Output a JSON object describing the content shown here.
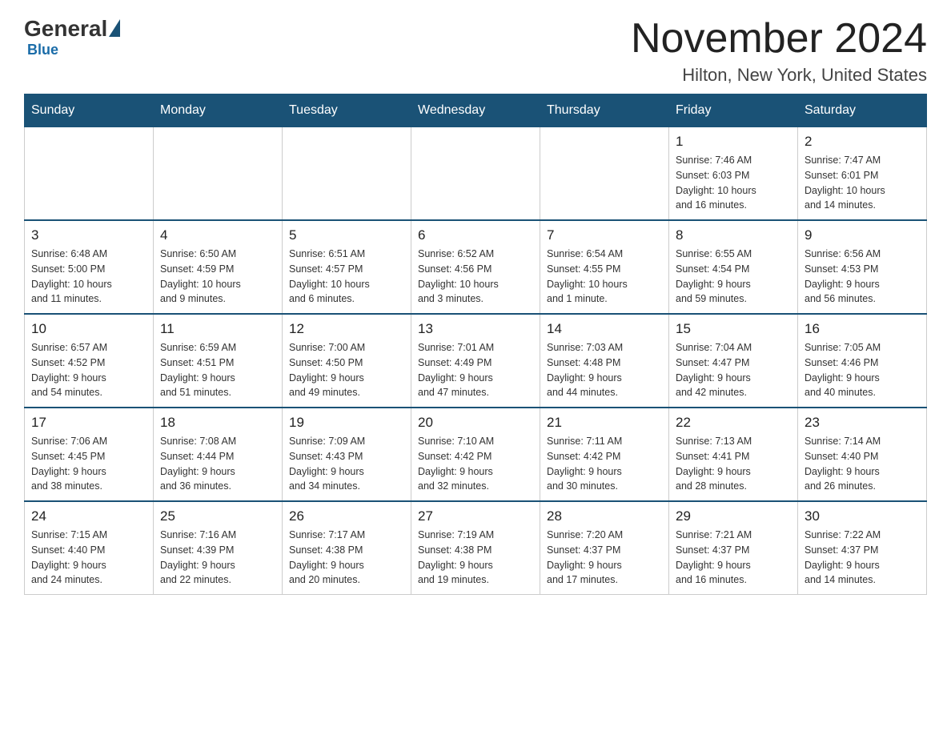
{
  "logo": {
    "general": "General",
    "blue": "Blue",
    "underline": "Blue"
  },
  "header": {
    "month_year": "November 2024",
    "location": "Hilton, New York, United States"
  },
  "weekdays": [
    "Sunday",
    "Monday",
    "Tuesday",
    "Wednesday",
    "Thursday",
    "Friday",
    "Saturday"
  ],
  "weeks": [
    [
      {
        "day": "",
        "info": ""
      },
      {
        "day": "",
        "info": ""
      },
      {
        "day": "",
        "info": ""
      },
      {
        "day": "",
        "info": ""
      },
      {
        "day": "",
        "info": ""
      },
      {
        "day": "1",
        "info": "Sunrise: 7:46 AM\nSunset: 6:03 PM\nDaylight: 10 hours\nand 16 minutes."
      },
      {
        "day": "2",
        "info": "Sunrise: 7:47 AM\nSunset: 6:01 PM\nDaylight: 10 hours\nand 14 minutes."
      }
    ],
    [
      {
        "day": "3",
        "info": "Sunrise: 6:48 AM\nSunset: 5:00 PM\nDaylight: 10 hours\nand 11 minutes."
      },
      {
        "day": "4",
        "info": "Sunrise: 6:50 AM\nSunset: 4:59 PM\nDaylight: 10 hours\nand 9 minutes."
      },
      {
        "day": "5",
        "info": "Sunrise: 6:51 AM\nSunset: 4:57 PM\nDaylight: 10 hours\nand 6 minutes."
      },
      {
        "day": "6",
        "info": "Sunrise: 6:52 AM\nSunset: 4:56 PM\nDaylight: 10 hours\nand 3 minutes."
      },
      {
        "day": "7",
        "info": "Sunrise: 6:54 AM\nSunset: 4:55 PM\nDaylight: 10 hours\nand 1 minute."
      },
      {
        "day": "8",
        "info": "Sunrise: 6:55 AM\nSunset: 4:54 PM\nDaylight: 9 hours\nand 59 minutes."
      },
      {
        "day": "9",
        "info": "Sunrise: 6:56 AM\nSunset: 4:53 PM\nDaylight: 9 hours\nand 56 minutes."
      }
    ],
    [
      {
        "day": "10",
        "info": "Sunrise: 6:57 AM\nSunset: 4:52 PM\nDaylight: 9 hours\nand 54 minutes."
      },
      {
        "day": "11",
        "info": "Sunrise: 6:59 AM\nSunset: 4:51 PM\nDaylight: 9 hours\nand 51 minutes."
      },
      {
        "day": "12",
        "info": "Sunrise: 7:00 AM\nSunset: 4:50 PM\nDaylight: 9 hours\nand 49 minutes."
      },
      {
        "day": "13",
        "info": "Sunrise: 7:01 AM\nSunset: 4:49 PM\nDaylight: 9 hours\nand 47 minutes."
      },
      {
        "day": "14",
        "info": "Sunrise: 7:03 AM\nSunset: 4:48 PM\nDaylight: 9 hours\nand 44 minutes."
      },
      {
        "day": "15",
        "info": "Sunrise: 7:04 AM\nSunset: 4:47 PM\nDaylight: 9 hours\nand 42 minutes."
      },
      {
        "day": "16",
        "info": "Sunrise: 7:05 AM\nSunset: 4:46 PM\nDaylight: 9 hours\nand 40 minutes."
      }
    ],
    [
      {
        "day": "17",
        "info": "Sunrise: 7:06 AM\nSunset: 4:45 PM\nDaylight: 9 hours\nand 38 minutes."
      },
      {
        "day": "18",
        "info": "Sunrise: 7:08 AM\nSunset: 4:44 PM\nDaylight: 9 hours\nand 36 minutes."
      },
      {
        "day": "19",
        "info": "Sunrise: 7:09 AM\nSunset: 4:43 PM\nDaylight: 9 hours\nand 34 minutes."
      },
      {
        "day": "20",
        "info": "Sunrise: 7:10 AM\nSunset: 4:42 PM\nDaylight: 9 hours\nand 32 minutes."
      },
      {
        "day": "21",
        "info": "Sunrise: 7:11 AM\nSunset: 4:42 PM\nDaylight: 9 hours\nand 30 minutes."
      },
      {
        "day": "22",
        "info": "Sunrise: 7:13 AM\nSunset: 4:41 PM\nDaylight: 9 hours\nand 28 minutes."
      },
      {
        "day": "23",
        "info": "Sunrise: 7:14 AM\nSunset: 4:40 PM\nDaylight: 9 hours\nand 26 minutes."
      }
    ],
    [
      {
        "day": "24",
        "info": "Sunrise: 7:15 AM\nSunset: 4:40 PM\nDaylight: 9 hours\nand 24 minutes."
      },
      {
        "day": "25",
        "info": "Sunrise: 7:16 AM\nSunset: 4:39 PM\nDaylight: 9 hours\nand 22 minutes."
      },
      {
        "day": "26",
        "info": "Sunrise: 7:17 AM\nSunset: 4:38 PM\nDaylight: 9 hours\nand 20 minutes."
      },
      {
        "day": "27",
        "info": "Sunrise: 7:19 AM\nSunset: 4:38 PM\nDaylight: 9 hours\nand 19 minutes."
      },
      {
        "day": "28",
        "info": "Sunrise: 7:20 AM\nSunset: 4:37 PM\nDaylight: 9 hours\nand 17 minutes."
      },
      {
        "day": "29",
        "info": "Sunrise: 7:21 AM\nSunset: 4:37 PM\nDaylight: 9 hours\nand 16 minutes."
      },
      {
        "day": "30",
        "info": "Sunrise: 7:22 AM\nSunset: 4:37 PM\nDaylight: 9 hours\nand 14 minutes."
      }
    ]
  ]
}
